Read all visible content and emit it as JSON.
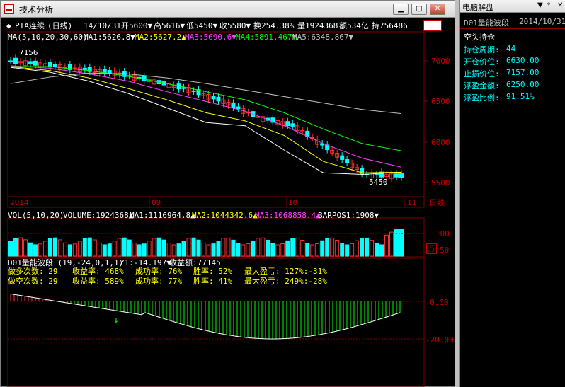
{
  "window": {
    "title": "技术分析",
    "min": "▁",
    "max": "▢",
    "close": "✕"
  },
  "header": {
    "symbol": "PTA连续",
    "period": "(日线)",
    "date": "14/10/31",
    "open": "开5600▼",
    "high": "高5616▼",
    "low": "低5450▼",
    "close": "收5580▼",
    "turnover": "换254.38%",
    "volume": "量1924368",
    "amount": "额534亿",
    "hold": "持756486"
  },
  "ma_line": {
    "label": "MA(5,10,20,30,60)",
    "ma1": "MA1:5626.8▼",
    "ma2": "MA2:5627.2▲",
    "ma3": "MA3:5690.6▼",
    "ma4": "MA4:5891.467▼",
    "ma5": "MA5:6348.867▼"
  },
  "price_chart": {
    "y_ticks": [
      "7000",
      "6500",
      "6000",
      "5500"
    ],
    "high_marker": "7156",
    "low_marker": "5450",
    "x_labels": [
      "2014",
      "09",
      "10",
      "11"
    ],
    "x_unit": "日线"
  },
  "vol_line": {
    "label": "VOL(5,10,20)",
    "volume": "VOLUME:1924368▲",
    "ma1": "MA1:1116964.8▲",
    "ma2": "MA2:1044342.6▲",
    "ma3": "MA3:1068858.4▲",
    "barpos": "BARPOS1:1908▼",
    "y_ticks": [
      "100",
      "50"
    ],
    "unit": "万"
  },
  "indicator": {
    "label": "D01量能波段 (19,-24,0,1,1)",
    "z1": "Z1:-14.197▼",
    "profit": "收益额:77145",
    "y_ticks": [
      "0.00",
      "-20.00"
    ],
    "rows": [
      {
        "a": "做多次数: 29",
        "b": "收益率: 468%",
        "c": "成功率: 76%",
        "d": "胜率: 52%",
        "e": "最大盈亏: 127%:-31%"
      },
      {
        "a": "做空次数: 29",
        "b": "收益率: 589%",
        "c": "成功率: 77%",
        "d": "胜率: 41%",
        "e": "最大盈亏: 249%:-28%"
      }
    ]
  },
  "colors": {
    "up": "#ff3030",
    "down": "#00ffff",
    "ma1": "#ffffff",
    "ma2": "#ffff00",
    "ma3": "#ff40ff",
    "ma4": "#00ff00",
    "ma5": "#c0c0c0",
    "grid": "#800000"
  },
  "chart_data": {
    "type": "line",
    "series": [
      {
        "name": "MA1",
        "values": [
          6920,
          6860,
          6750,
          6600,
          6420,
          6240,
          6200,
          5900,
          5620,
          5600,
          5627
        ]
      },
      {
        "name": "MA2",
        "values": [
          6930,
          6880,
          6790,
          6660,
          6520,
          6360,
          6260,
          6080,
          5760,
          5620,
          5627
        ]
      },
      {
        "name": "MA3",
        "values": [
          6940,
          6910,
          6840,
          6750,
          6620,
          6500,
          6380,
          6200,
          5980,
          5800,
          5690
        ]
      },
      {
        "name": "MA4",
        "values": [
          6930,
          6930,
          6880,
          6810,
          6720,
          6620,
          6520,
          6360,
          6160,
          5980,
          5891
        ]
      },
      {
        "name": "MA5",
        "values": [
          6720,
          6800,
          6850,
          6840,
          6790,
          6720,
          6640,
          6560,
          6480,
          6400,
          6349
        ]
      }
    ],
    "candles_approx": [
      7000,
      6950,
      6900,
      6850,
      6750,
      6650,
      6500,
      6300,
      6200,
      5900,
      5600,
      5580
    ]
  },
  "right_panel": {
    "title": "电脑解盘",
    "dropdown": "▼",
    "pin": "ᵠ",
    "close": "✕",
    "strategy": "D01量能波段",
    "date": "2014/10/31",
    "status": "空头持仓",
    "items": [
      {
        "label": "持仓周期:",
        "value": "44"
      },
      {
        "label": "开仓价位:",
        "value": "6630.00"
      },
      {
        "label": "止损价位:",
        "value": "7157.00"
      },
      {
        "label": "浮盈金额:",
        "value": "6250.00"
      },
      {
        "label": "浮盈比例:",
        "value": "91.51%"
      }
    ]
  }
}
